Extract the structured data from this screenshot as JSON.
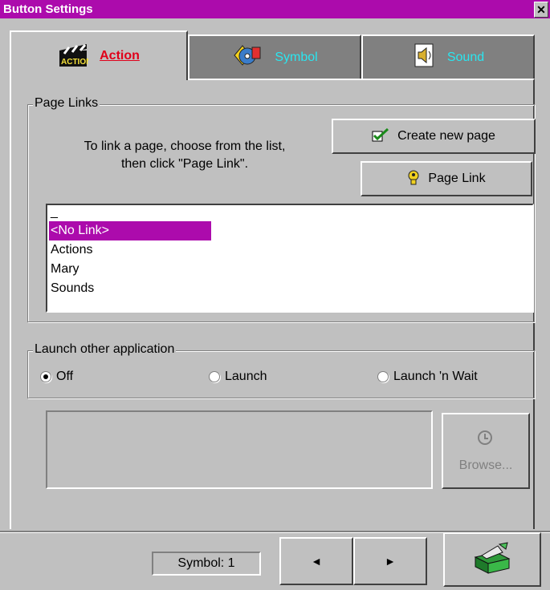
{
  "window": {
    "title": "Button Settings",
    "close_glyph": "✕"
  },
  "tabs": [
    {
      "label": "Action",
      "icon": "clapperboard-icon",
      "active": true
    },
    {
      "label": "Symbol",
      "icon": "symbol-cd-icon",
      "active": false
    },
    {
      "label": "Sound",
      "icon": "speaker-icon",
      "active": false
    }
  ],
  "page_links": {
    "group_title": "Page Links",
    "instructions_line1": "To link a page, choose from the list,",
    "instructions_line2": "then click \"Page Link\".",
    "create_new_page_label": "Create new page",
    "page_link_label": "Page Link",
    "list_items": [
      "_",
      "<No Link>",
      "Actions",
      "Mary",
      "Sounds"
    ],
    "selected_item": "<No Link>"
  },
  "launch": {
    "group_title": "Launch other application",
    "options": [
      "Off",
      "Launch",
      "Launch 'n Wait"
    ],
    "selected": "Off",
    "browse_label": "Browse..."
  },
  "footer": {
    "symbol_label": "Symbol: 1",
    "prev_glyph": "◄",
    "next_glyph": "►"
  },
  "colors": {
    "titlebar": "#ac0bac",
    "selection": "#ac0bac",
    "active_tab_text": "#e0001a",
    "inactive_tab_text": "#29e6f0"
  }
}
